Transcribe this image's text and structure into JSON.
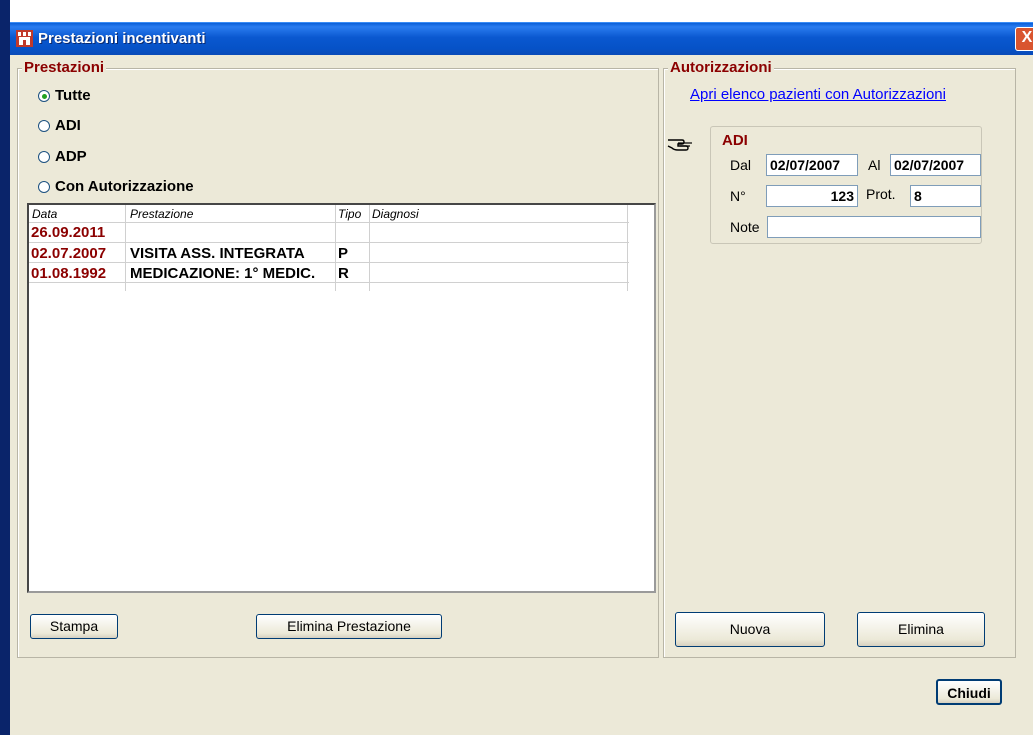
{
  "window": {
    "title": "Prestazioni incentivanti",
    "close_label": "X"
  },
  "prestazioni": {
    "group_title": "Prestazioni",
    "filters": [
      {
        "label": "Tutte",
        "selected": true
      },
      {
        "label": "ADI",
        "selected": false
      },
      {
        "label": "ADP",
        "selected": false
      },
      {
        "label": "Con Autorizzazione",
        "selected": false
      }
    ],
    "table": {
      "headers": [
        "Data",
        "Prestazione",
        "Tipo",
        "Diagnosi"
      ],
      "rows": [
        {
          "data": "26.09.2011",
          "prestazione": "",
          "tipo": "",
          "diagnosi": ""
        },
        {
          "data": "02.07.2007",
          "prestazione": "VISITA ASS. INTEGRATA",
          "tipo": "P",
          "diagnosi": ""
        },
        {
          "data": "01.08.1992",
          "prestazione": "MEDICAZIONE: 1° MEDIC.",
          "tipo": "R",
          "diagnosi": ""
        }
      ]
    },
    "stampa_label": "Stampa",
    "elimina_prestazione_label": "Elimina Prestazione"
  },
  "autorizzazioni": {
    "group_title": "Autorizzazioni",
    "link_text": "Apri elenco pazienti con Autorizzazioni",
    "pointer_icon": "pointing-hand-icon",
    "adi": {
      "title": "ADI",
      "dal_label": "Dal",
      "dal_value": "02/07/2007",
      "al_label": "Al",
      "al_value": "02/07/2007",
      "n_label": "N°",
      "n_value": "123",
      "prot_label": "Prot.",
      "prot_value": "8",
      "note_label": "Note",
      "note_value": ""
    },
    "nuova_label": "Nuova",
    "elimina_label": "Elimina"
  },
  "chiudi_label": "Chiudi",
  "colors": {
    "accent": "#8b0000",
    "titlebar": "#0a58d0",
    "link": "#0000ff"
  }
}
